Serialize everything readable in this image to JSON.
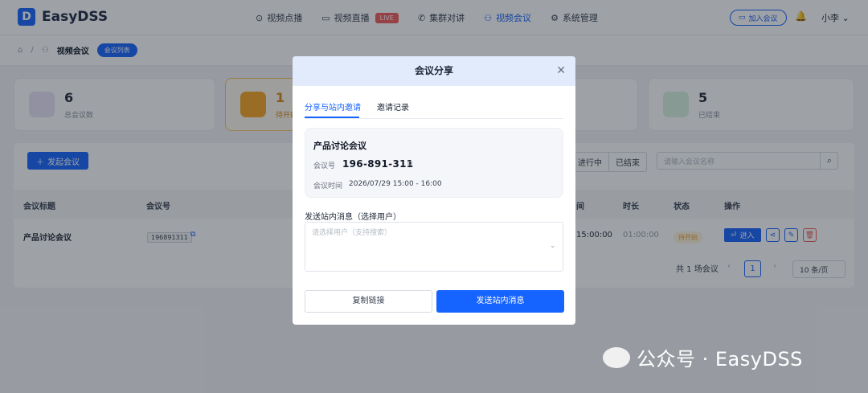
{
  "app": {
    "name": "EasyDSS",
    "logo_letter": "D"
  },
  "nav": [
    {
      "label": "视频点播",
      "icon": "play-circle-icon",
      "glyph": "⊙"
    },
    {
      "label": "视频直播",
      "icon": "video-camera-icon",
      "glyph": "▭",
      "badge": "LIVE"
    },
    {
      "label": "集群对讲",
      "icon": "phone-icon",
      "glyph": "✆"
    },
    {
      "label": "视频会议",
      "icon": "meeting-users-icon",
      "glyph": "⚇",
      "active": true
    },
    {
      "label": "系统管理",
      "icon": "gear-icon",
      "glyph": "⚙"
    }
  ],
  "header": {
    "join_label": "加入会议",
    "user": "小李",
    "join_icon": "camera-icon",
    "bell_icon": "bell-icon"
  },
  "breadcrumb": {
    "home_icon": "home-icon",
    "section": "视频会议",
    "tag": "会议列表"
  },
  "stats": [
    {
      "value": "6",
      "label": "总会议数",
      "color": "#e8e3f9",
      "icon": "users-icon"
    },
    {
      "value": "1",
      "label": "待开始",
      "color": "#f6a623",
      "icon": "clock-icon"
    },
    {
      "value": "5",
      "label": "已结束",
      "color": "#d7f3e0",
      "icon": "check-circle-icon"
    }
  ],
  "toolbar": {
    "new_label": "发起会议",
    "filters": [
      "进行中",
      "已结束"
    ],
    "search_placeholder": "请输入会议名称"
  },
  "table": {
    "headers": {
      "title": "会议标题",
      "id": "会议号",
      "time": "间",
      "duration": "时长",
      "status": "状态",
      "ops": "操作"
    },
    "row": {
      "title": "产品讨论会议",
      "id": "196891311",
      "time": "15:00:00",
      "duration": "01:00:00",
      "status": "待开始",
      "enter": "进入"
    }
  },
  "pagination": {
    "total": "共 1 场会议",
    "page": "1",
    "page_size": "10 条/页"
  },
  "modal": {
    "title": "会议分享",
    "tabs": [
      "分享与站内邀请",
      "邀请记录"
    ],
    "meeting_title": "产品讨论会议",
    "id_label": "会议号",
    "id_value": "196-891-311",
    "time_label": "会议时间",
    "time_value": "2026/07/29 15:00 - 16:00",
    "send_label": "发送站内消息（选择用户）",
    "select_placeholder": "请选择用户（支持搜索）",
    "copy_label": "复制链接",
    "send_button": "发送站内消息"
  },
  "watermark": "公众号 · EasyDSS",
  "colors": {
    "primary": "#1664ff",
    "live": "#ef5a5a",
    "pending": "#f29b2a"
  }
}
